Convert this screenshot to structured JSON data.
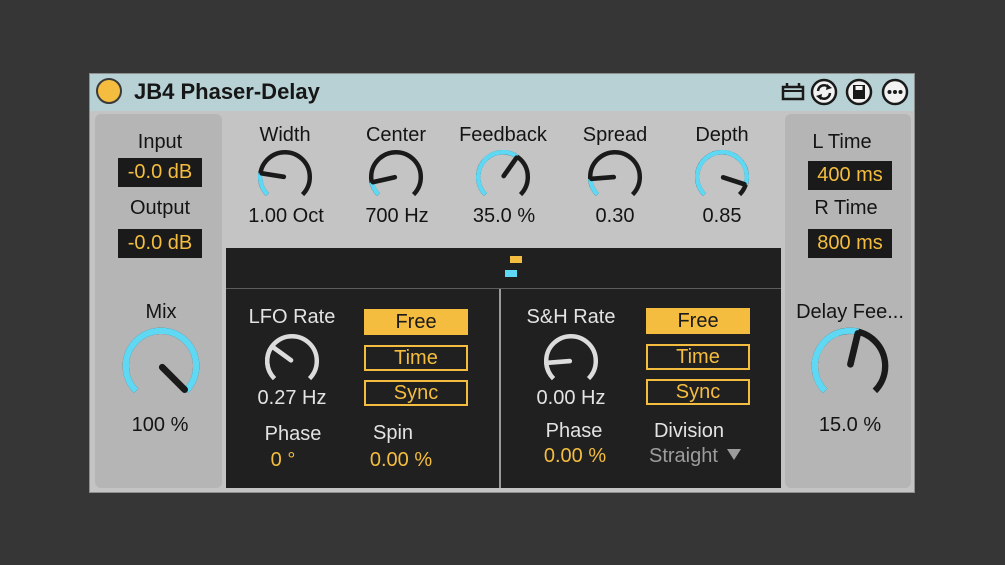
{
  "device": {
    "title": "JB4 Phaser-Delay",
    "accent": "#f4bd3f",
    "arc_color": "#5fd8f4",
    "titlebar_color": "#b7d1d5",
    "titlebar_icons": [
      "hot-swap-icon",
      "refresh-icon",
      "save-icon",
      "more-options-icon"
    ]
  },
  "left": {
    "input_label": "Input",
    "input_value": "-0.0 dB",
    "output_label": "Output",
    "output_value": "-0.0 dB",
    "mix_label": "Mix",
    "mix_value": "100 %",
    "mix_level": 1.0
  },
  "top_knobs": [
    {
      "label": "Width",
      "value": "1.00 Oct",
      "level": 0.2
    },
    {
      "label": "Center",
      "value": "700 Hz",
      "level": 0.12
    },
    {
      "label": "Feedback",
      "value": "35.0 %",
      "level": 0.63
    },
    {
      "label": "Spread",
      "value": "0.30",
      "level": 0.15
    },
    {
      "label": "Depth",
      "value": "0.85",
      "level": 0.9
    }
  ],
  "lfo": {
    "rate_label": "LFO Rate",
    "rate_value": "0.27 Hz",
    "rate_level": 0.3,
    "modes": [
      "Free",
      "Time",
      "Sync"
    ],
    "active_mode": "Free",
    "phase_label": "Phase",
    "phase_value": "0 °",
    "spin_label": "Spin",
    "spin_value": "0.00 %"
  },
  "sh": {
    "rate_label": "S&H Rate",
    "rate_value": "0.00 Hz",
    "rate_level": 0.15,
    "modes": [
      "Free",
      "Time",
      "Sync"
    ],
    "active_mode": "Free",
    "phase_label": "Phase",
    "phase_value": "0.00 %",
    "division_label": "Division",
    "division_value": "Straight"
  },
  "right": {
    "ltime_label": "L Time",
    "ltime_value": "400 ms",
    "rtime_label": "R Time",
    "rtime_value": "800 ms",
    "feedback_label": "Delay Fee...",
    "feedback_value": "15.0 %",
    "feedback_level": 0.55
  }
}
